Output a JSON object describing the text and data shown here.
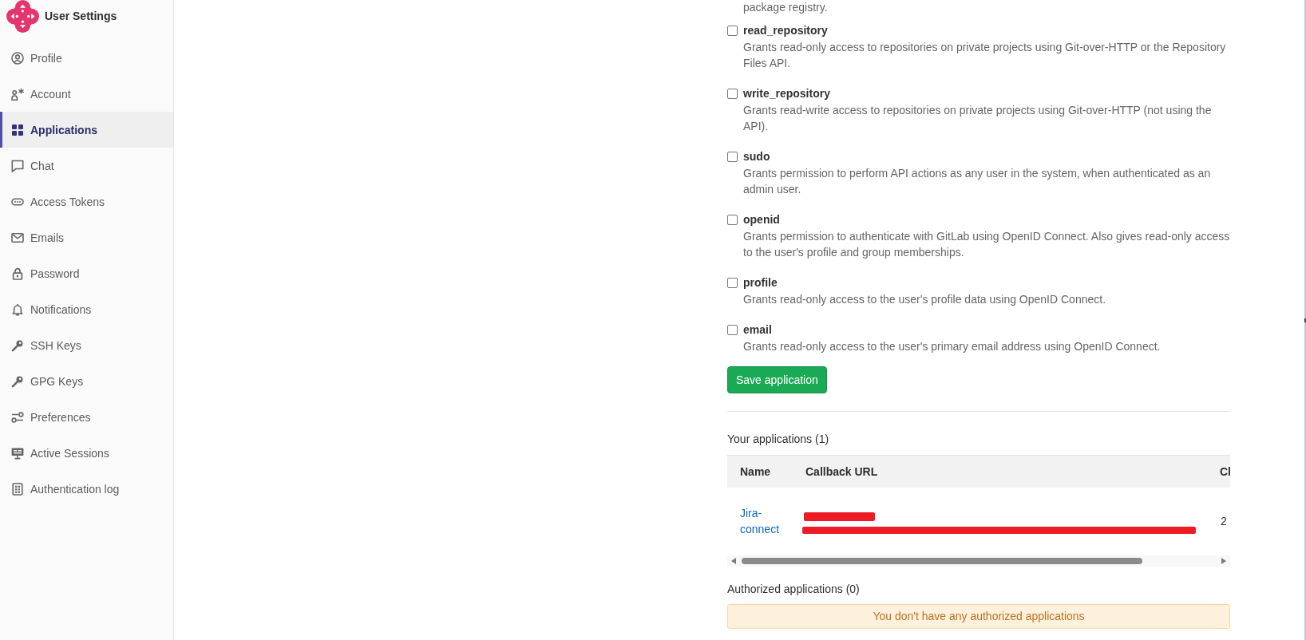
{
  "sidebar": {
    "title": "User Settings",
    "items": [
      {
        "label": "Profile",
        "selected": false
      },
      {
        "label": "Account",
        "selected": false
      },
      {
        "label": "Applications",
        "selected": true
      },
      {
        "label": "Chat",
        "selected": false
      },
      {
        "label": "Access Tokens",
        "selected": false
      },
      {
        "label": "Emails",
        "selected": false
      },
      {
        "label": "Password",
        "selected": false
      },
      {
        "label": "Notifications",
        "selected": false
      },
      {
        "label": "SSH Keys",
        "selected": false
      },
      {
        "label": "GPG Keys",
        "selected": false
      },
      {
        "label": "Preferences",
        "selected": false
      },
      {
        "label": "Active Sessions",
        "selected": false
      },
      {
        "label": "Authentication log",
        "selected": false
      }
    ]
  },
  "scopes": {
    "cut_description": "package registry.",
    "items": [
      {
        "name": "read_repository",
        "checked": false,
        "description": "Grants read-only access to repositories on private projects using Git-over-HTTP or the Repository Files API."
      },
      {
        "name": "write_repository",
        "checked": false,
        "description": "Grants read-write access to repositories on private projects using Git-over-HTTP (not using the API)."
      },
      {
        "name": "sudo",
        "checked": false,
        "description": "Grants permission to perform API actions as any user in the system, when authenticated as an admin user."
      },
      {
        "name": "openid",
        "checked": false,
        "description": "Grants permission to authenticate with GitLab using OpenID Connect. Also gives read-only access to the user's profile and group memberships."
      },
      {
        "name": "profile",
        "checked": false,
        "description": "Grants read-only access to the user's profile data using OpenID Connect."
      },
      {
        "name": "email",
        "checked": false,
        "description": "Grants read-only access to the user's primary email address using OpenID Connect."
      }
    ]
  },
  "save_button": "Save application",
  "your_applications": {
    "heading": "Your applications (1)",
    "table": {
      "columns": [
        "Name",
        "Callback URL",
        "Cl"
      ],
      "rows": [
        {
          "name": "Jira-connect",
          "callback_url_redacted": true,
          "column_3": "2"
        }
      ]
    }
  },
  "authorized_applications": {
    "heading": "Authorized applications (0)",
    "empty_message": "You don't have any authorized applications"
  }
}
